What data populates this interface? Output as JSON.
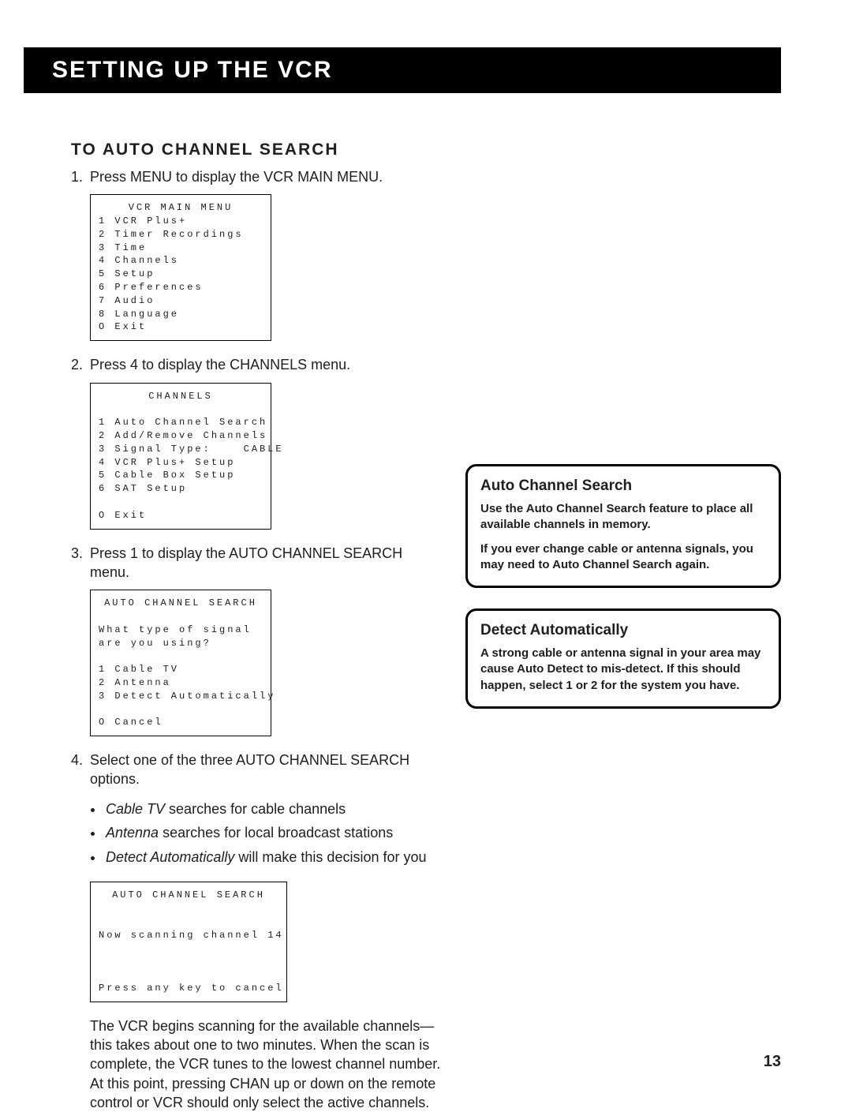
{
  "header": "SETTING UP THE VCR",
  "section_heading": "TO AUTO CHANNEL SEARCH",
  "steps": {
    "s1": {
      "num": "1.",
      "text": "Press MENU to display the VCR MAIN MENU."
    },
    "s2": {
      "num": "2.",
      "text": "Press 4 to display the CHANNELS menu."
    },
    "s3": {
      "num": "3.",
      "text": "Press 1 to display the AUTO CHANNEL SEARCH menu."
    },
    "s4": {
      "num": "4.",
      "text": "Select one of the three AUTO CHANNEL SEARCH options."
    }
  },
  "menu1": {
    "title": "VCR MAIN MENU",
    "l1": "1 VCR Plus+",
    "l2": "2 Timer Recordings",
    "l3": "3 Time",
    "l4": "4 Channels",
    "l5": "5 Setup",
    "l6": "6 Preferences",
    "l7": "7 Audio",
    "l8": "8 Language",
    "l9": "O Exit"
  },
  "menu2": {
    "title": "CHANNELS",
    "l1": "1 Auto Channel Search",
    "l2": "2 Add/Remove Channels",
    "l3": "3 Signal Type:    CABLE",
    "l4": "4 VCR Plus+ Setup",
    "l5": "5 Cable Box Setup",
    "l6": "6 SAT Setup",
    "l7": "O Exit"
  },
  "menu3": {
    "title": "AUTO CHANNEL SEARCH",
    "l1": "What type of signal",
    "l2": "are you using?",
    "l3": "1 Cable TV",
    "l4": "2 Antenna",
    "l5": "3 Detect Automatically",
    "l6": "O Cancel"
  },
  "bullets": {
    "b1_i": "Cable TV",
    "b1_r": " searches for cable channels",
    "b2_i": "Antenna",
    "b2_r": " searches for local broadcast stations",
    "b3_i": "Detect Automatically",
    "b3_r": " will make this decision for you"
  },
  "menu4": {
    "title": "AUTO CHANNEL SEARCH",
    "l1": "Now scanning channel 14",
    "l2": "Press any key to cancel"
  },
  "final_para": "The VCR begins scanning for the available channels—this takes about one to two minutes. When the scan is complete, the VCR tunes to the lowest channel number. At this point, pressing CHAN up or down on the remote control or VCR should only select the active channels.",
  "callout1": {
    "title": "Auto Channel Search",
    "p1": "Use the Auto Channel Search feature to place all available channels in memory.",
    "p2": "If you ever change cable or antenna signals, you may need to Auto Channel Search again."
  },
  "callout2": {
    "title": "Detect Automatically",
    "p1": "A strong cable or antenna signal in your area may cause Auto Detect to mis-detect. If this should happen, select 1 or 2 for the system you have."
  },
  "page_number": "13"
}
